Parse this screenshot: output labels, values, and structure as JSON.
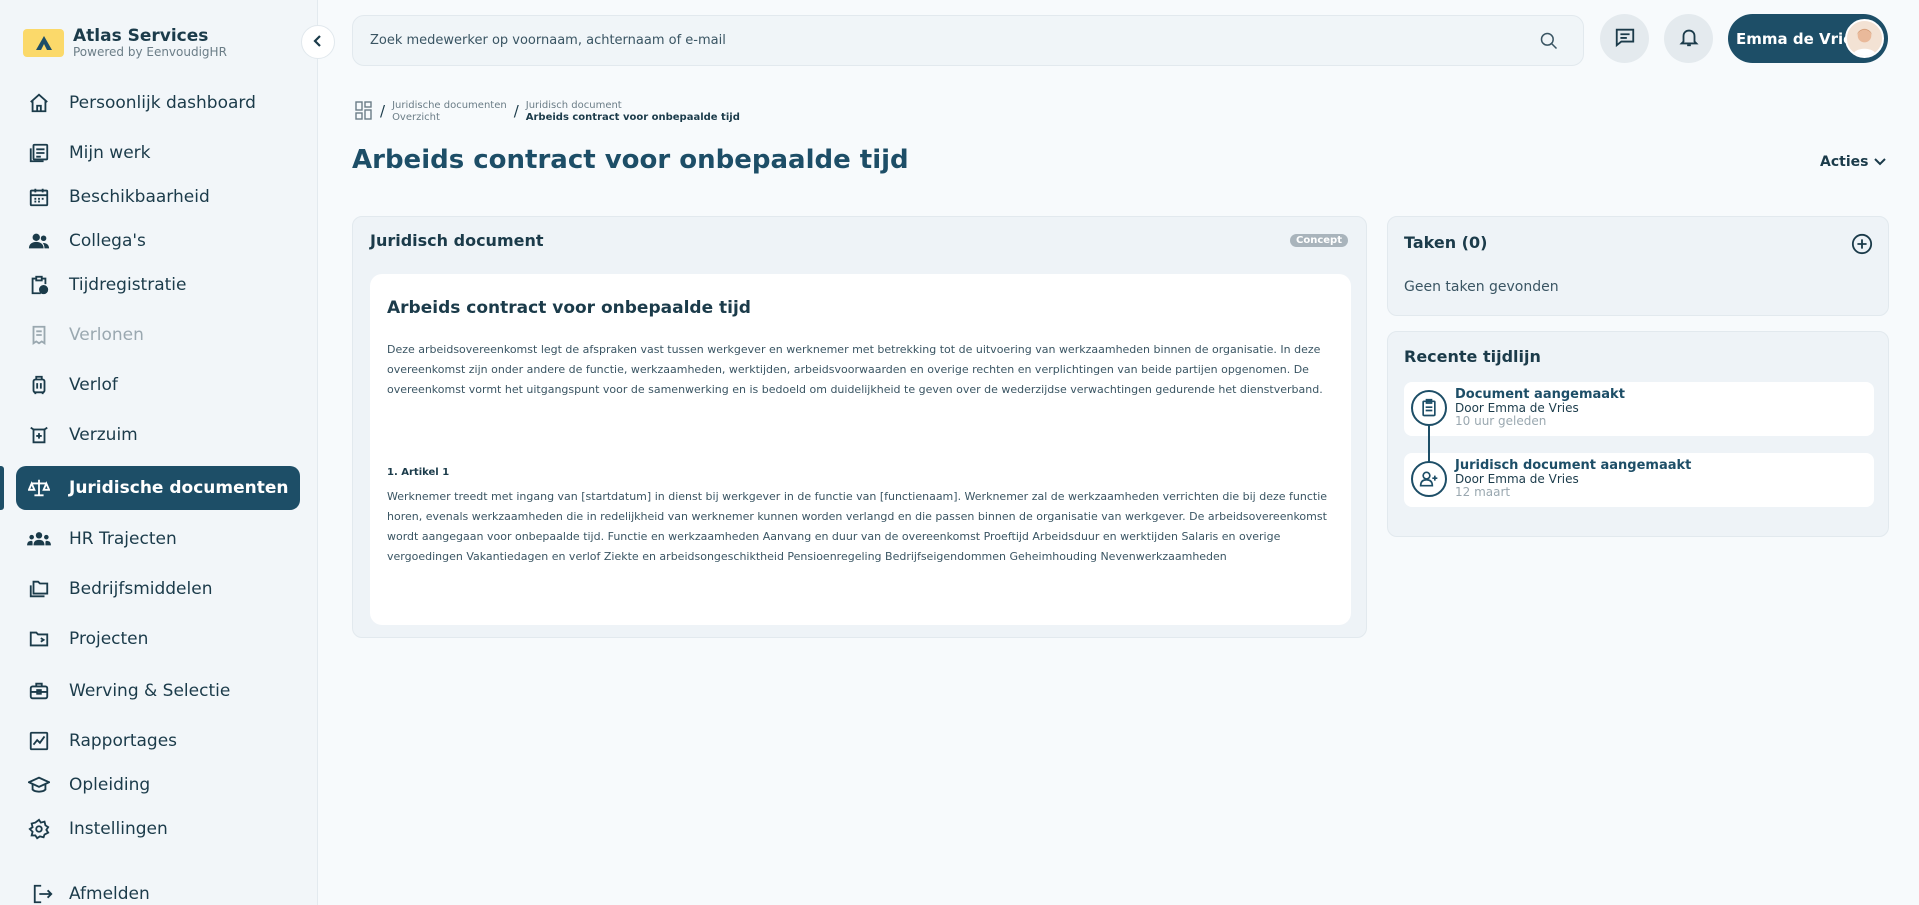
{
  "brand": {
    "name": "Atlas Services",
    "powered_by": "Powered by EenvoudigHR"
  },
  "sidebar": {
    "items": [
      {
        "label": "Persoonlijk dashboard",
        "icon": "home-icon"
      },
      {
        "label": "Mijn werk",
        "icon": "document-list-icon"
      },
      {
        "label": "Beschikbaarheid",
        "icon": "calendar-icon"
      },
      {
        "label": "Collega's",
        "icon": "people-icon"
      },
      {
        "label": "Tijdregistratie",
        "icon": "clipboard-clock-icon"
      },
      {
        "label": "Verlonen",
        "icon": "receipt-icon",
        "disabled": true
      },
      {
        "label": "Verlof",
        "icon": "luggage-icon"
      },
      {
        "label": "Verzuim",
        "icon": "hospital-icon"
      },
      {
        "label": "Juridische documenten",
        "icon": "scales-icon",
        "active": true
      },
      {
        "label": "HR Trajecten",
        "icon": "group-icon"
      },
      {
        "label": "Bedrijfsmiddelen",
        "icon": "folders-icon"
      },
      {
        "label": "Projecten",
        "icon": "folder-icon"
      },
      {
        "label": "Werving & Selectie",
        "icon": "briefcase-icon"
      },
      {
        "label": "Rapportages",
        "icon": "chart-icon"
      },
      {
        "label": "Opleiding",
        "icon": "graduation-cap-icon"
      },
      {
        "label": "Instellingen",
        "icon": "gear-icon"
      }
    ],
    "logout": "Afmelden"
  },
  "search": {
    "placeholder": "Zoek medewerker op voornaam, achternaam of e-mail"
  },
  "user": {
    "name": "Emma de Vries"
  },
  "breadcrumb": {
    "crumb1_line1": "Juridische documenten",
    "crumb1_line2": "Overzicht",
    "crumb2_line1": "Juridisch document",
    "crumb2_line2": "Arbeids contract voor onbepaalde tijd",
    "separator": "/"
  },
  "page": {
    "title": "Arbeids contract voor onbepaalde tijd",
    "actions_label": "Acties"
  },
  "document_card": {
    "heading": "Juridisch document",
    "badge": "Concept",
    "doc_title": "Arbeids contract voor onbepaalde tijd",
    "intro": "Deze arbeidsovereenkomst legt de afspraken vast tussen werkgever en werknemer met betrekking tot de uitvoering van werkzaamheden binnen de organisatie. In deze overeenkomst zijn onder andere de functie, werkzaamheden, werktijden, arbeidsvoorwaarden en overige rechten en verplichtingen van beide partijen opgenomen. De overeenkomst vormt het uitgangspunt voor de samenwerking en is bedoeld om duidelijkheid te geven over de wederzijdse verwachtingen gedurende het dienstverband.",
    "article_title": "1. Artikel 1",
    "article_text": "Werknemer treedt met ingang van [startdatum] in dienst bij werkgever in de functie van [functienaam]. Werknemer zal de werkzaamheden verrichten die bij deze functie horen, evenals werkzaamheden die in redelijkheid van werknemer kunnen worden verlangd en die passen binnen de organisatie van werkgever. De arbeidsovereenkomst wordt aangegaan voor onbepaalde tijd. Functie en werkzaamheden Aanvang en duur van de overeenkomst Proeftijd Arbeidsduur en werktijden Salaris en overige vergoedingen Vakantiedagen en verlof Ziekte en arbeidsongeschiktheid Pensioenregeling Bedrijfseigendommen Geheimhouding Nevenwerkzaamheden"
  },
  "tasks": {
    "title": "Taken (0)",
    "empty": "Geen taken gevonden"
  },
  "timeline": {
    "title": "Recente tijdlijn",
    "items": [
      {
        "title": "Document aangemaakt",
        "by": "Door Emma de Vries",
        "time": "10 uur geleden",
        "icon": "document-icon"
      },
      {
        "title": "Juridisch document aangemaakt",
        "by": "Door Emma de Vries",
        "time": "12 maart",
        "icon": "user-add-icon"
      }
    ]
  },
  "colors": {
    "primary": "#1d4e67",
    "sidebar_bg": "#f2f6f9",
    "badge": "#a9b4bc",
    "brand_yellow": "#fbd96a"
  }
}
